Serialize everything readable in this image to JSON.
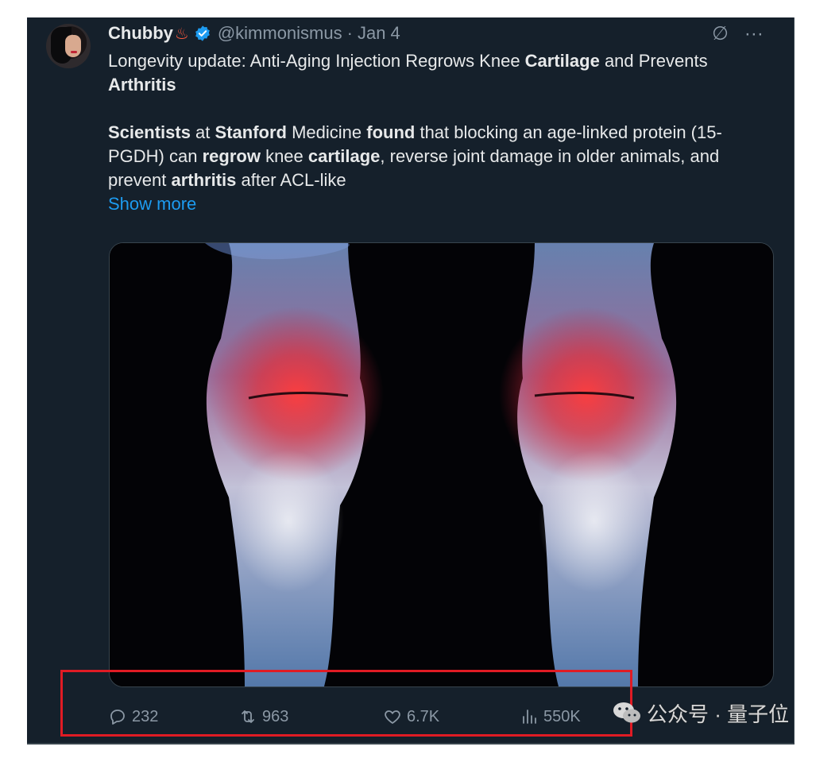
{
  "tweet": {
    "author_name": "Chubby",
    "name_emoji": "♨",
    "handle": "@kimmonismus",
    "separator": "·",
    "date": "Jan 4",
    "grok_icon": "∅",
    "more_icon": "···",
    "headline": {
      "part1": "Longevity update: Anti-Aging Injection Regrows Knee ",
      "bold1": "Cartilage",
      "part2": " and Prevents ",
      "bold2": "Arthritis"
    },
    "body": {
      "b1": "Scientists",
      "t1": " at ",
      "b2": "Stanford",
      "t2": " Medicine ",
      "b3": "found",
      "t3": " that blocking an age-linked protein (15-PGDH) can ",
      "b4": "regrow",
      "t4": " knee ",
      "b5": "cartilage",
      "t5": ", reverse joint damage in older animals, and prevent ",
      "b6": "arthritis",
      "t6": " after ACL-like"
    },
    "show_more": "Show more",
    "metrics": {
      "replies": "232",
      "reposts": "963",
      "likes": "6.7K",
      "views": "550K"
    }
  },
  "icons": {
    "verified": "verified-badge-icon",
    "reply": "reply-icon",
    "repost": "repost-icon",
    "like": "heart-icon",
    "views": "views-chart-icon",
    "watermark": "wechat-icon"
  },
  "watermark": {
    "text": "公众号 · 量子位"
  },
  "colors": {
    "background": "#15202b",
    "text": "#e7e9ea",
    "muted": "#8b98a5",
    "link": "#1d9bf0",
    "highlight_box": "#e01b24"
  }
}
